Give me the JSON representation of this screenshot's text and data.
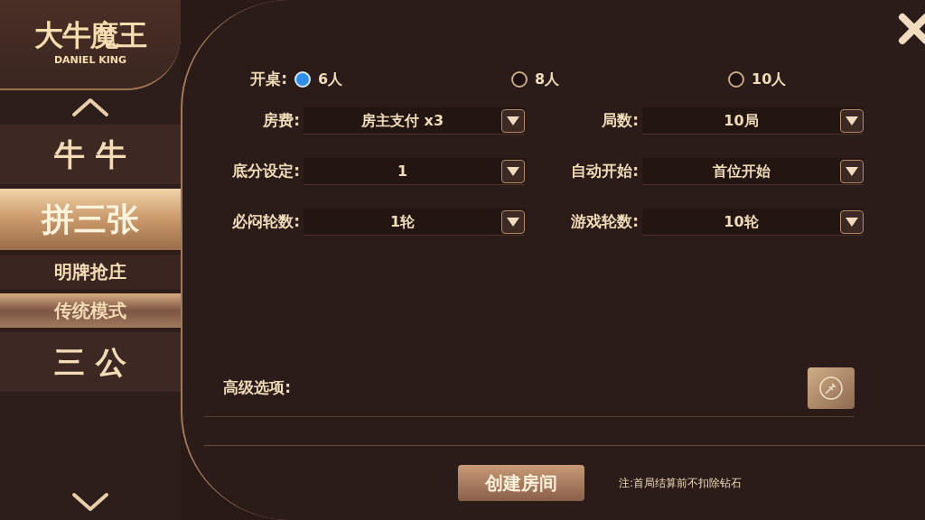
{
  "logo": {
    "title": "大牛魔王",
    "subtitle": "DANIEL KING"
  },
  "sidebar": {
    "items": [
      {
        "label": "牛 牛",
        "selected": false
      },
      {
        "label": "拼三张",
        "selected": true,
        "children": [
          {
            "label": "明牌抢庄",
            "selected": false
          },
          {
            "label": "传统模式",
            "selected": true
          }
        ]
      },
      {
        "label": "三 公",
        "selected": false
      }
    ]
  },
  "table_size": {
    "label": "开桌:",
    "options": [
      {
        "label": "6人",
        "selected": true
      },
      {
        "label": "8人",
        "selected": false
      },
      {
        "label": "10人",
        "selected": false
      }
    ]
  },
  "settings": [
    {
      "label": "房费:",
      "value": "房主支付 x3"
    },
    {
      "label": "局数:",
      "value": "10局"
    },
    {
      "label": "底分设定:",
      "value": "1"
    },
    {
      "label": "自动开始:",
      "value": "首位开始"
    },
    {
      "label": "必闷轮数:",
      "value": "1轮"
    },
    {
      "label": "游戏轮数:",
      "value": "10轮"
    }
  ],
  "advanced": {
    "label": "高级选项:"
  },
  "create_button": "创建房间",
  "note": "注:首局结算前不扣除钻石"
}
